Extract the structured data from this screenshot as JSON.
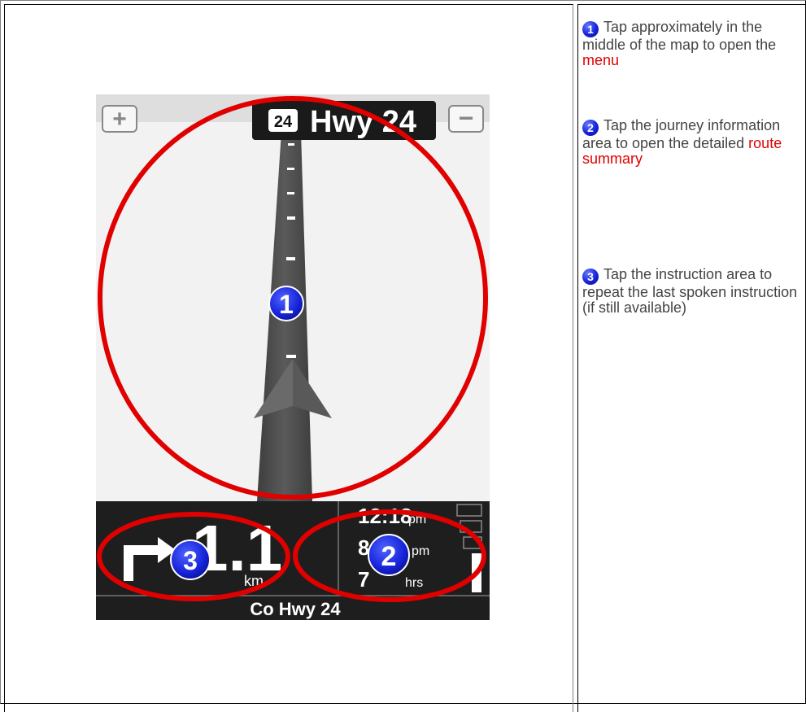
{
  "steps": [
    {
      "number": "1",
      "text_before": "Tap approximately in the middle of the map to open the ",
      "link": "menu",
      "text_after": ""
    },
    {
      "number": "2",
      "text_before": "Tap the journey information area to open the detailed ",
      "link": "route summary",
      "text_after": ""
    },
    {
      "number": "3",
      "text_before": "Tap the instruction area to repeat the last spoken instruction (if still available)",
      "link": "",
      "text_after": ""
    }
  ],
  "device": {
    "zoom_in_label": "+",
    "zoom_out_label": "−",
    "road_shield": "24",
    "road_name": "Hwy 24",
    "distance": "1.1",
    "distance_unit": "km",
    "time_value": "12:18",
    "time_suffix": "pm",
    "arrival_value": "8",
    "arrival_suffix": "pm",
    "duration_value": "7",
    "duration_suffix": "hrs",
    "current_street": "Co Hwy 24",
    "markers": [
      "1",
      "2",
      "3"
    ]
  },
  "colors": {
    "highlight_ellipse": "#e00000",
    "marker_blue": "#1522d8",
    "link_red": "#e00000",
    "nav_panel": "#1e1e1e"
  }
}
